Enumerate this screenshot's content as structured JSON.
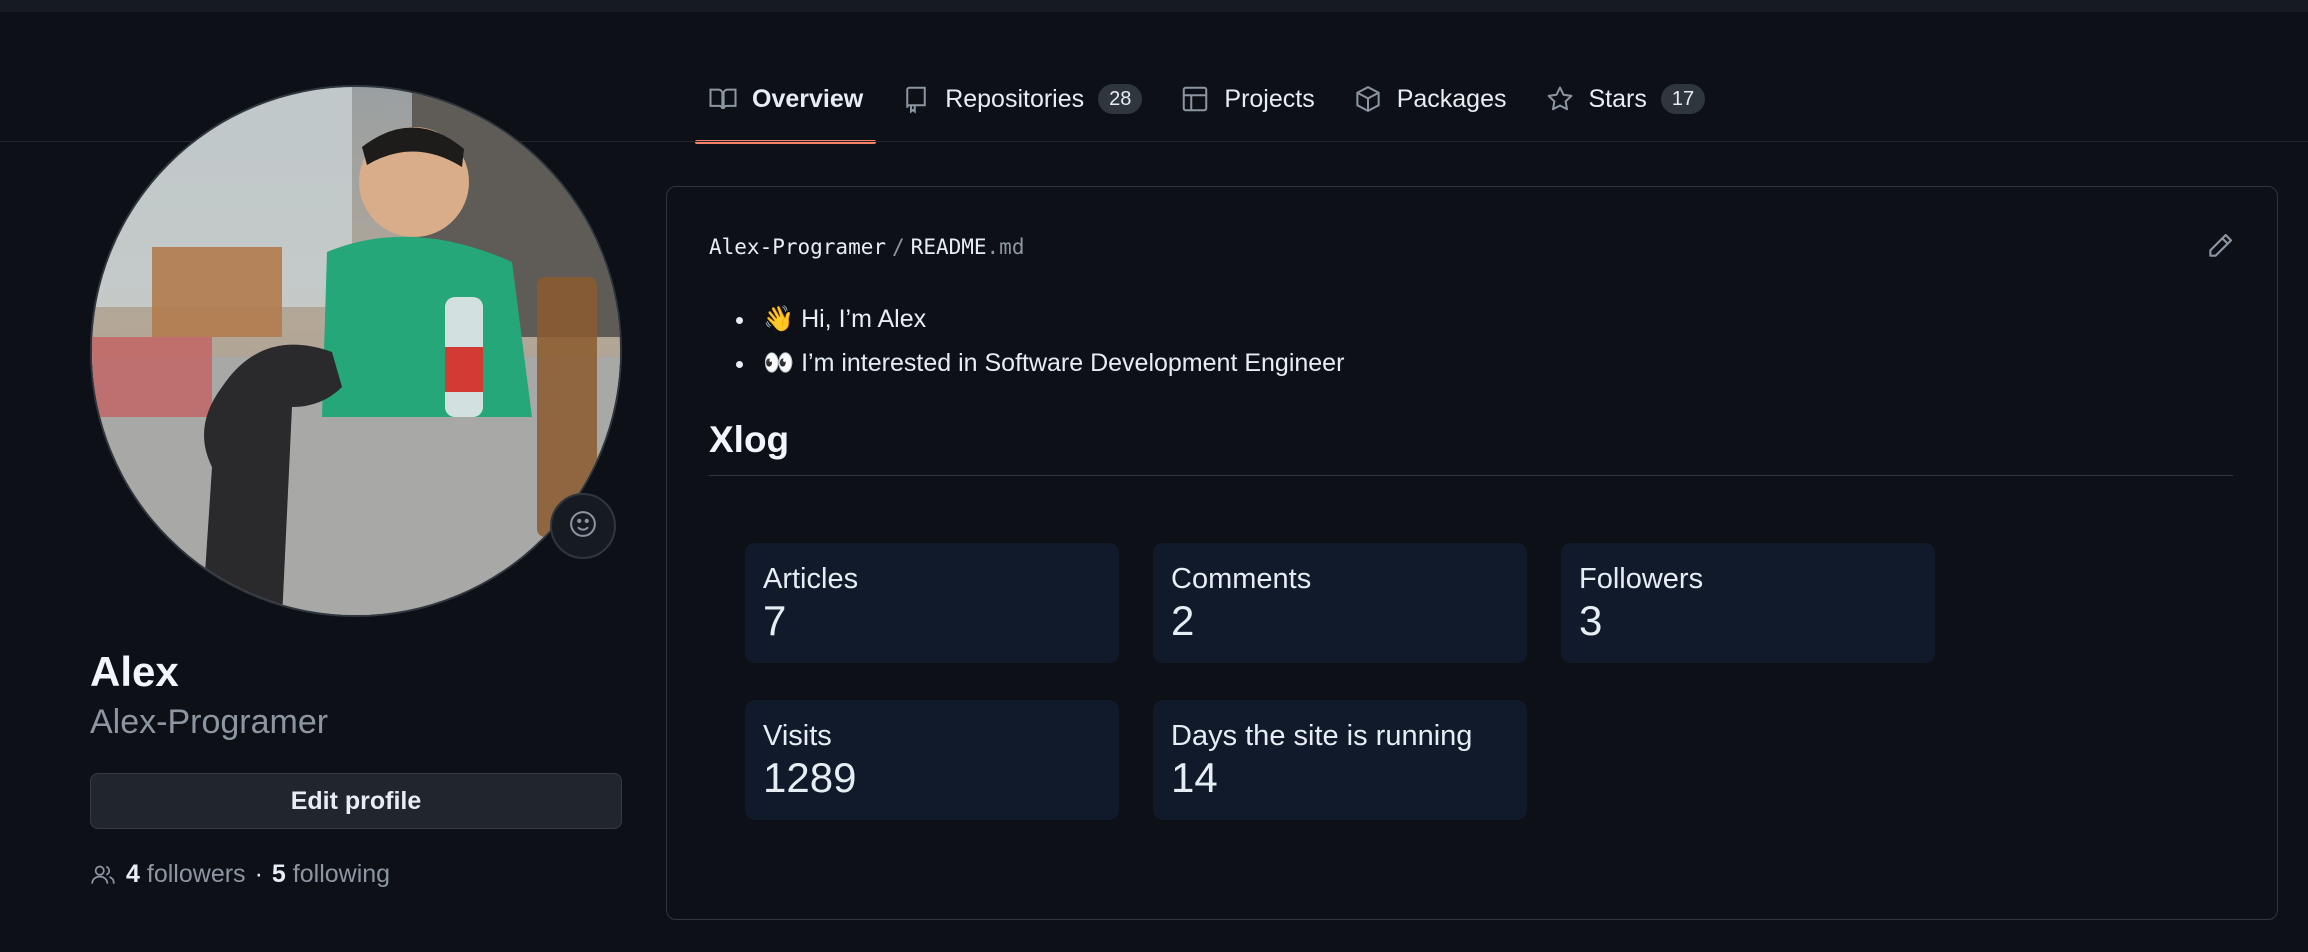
{
  "tabs": [
    {
      "label": "Overview",
      "icon": "book-icon",
      "selected": true
    },
    {
      "label": "Repositories",
      "icon": "repo-icon",
      "count": "28"
    },
    {
      "label": "Projects",
      "icon": "table-icon"
    },
    {
      "label": "Packages",
      "icon": "package-icon"
    },
    {
      "label": "Stars",
      "icon": "star-icon",
      "count": "17"
    }
  ],
  "profile": {
    "name": "Alex",
    "login": "Alex-Programer",
    "edit_label": "Edit profile",
    "followers_count": "4",
    "followers_label": "followers",
    "separator": "·",
    "following_count": "5",
    "following_label": "following"
  },
  "readme": {
    "owner": "Alex-Programer",
    "separator": "/",
    "file": "README",
    "ext": ".md",
    "bullets": [
      "👋 Hi, I’m Alex",
      "👀 I’m interested in Software Development Engineer"
    ],
    "heading": "Xlog",
    "stats": [
      {
        "label": "Articles",
        "value": "7"
      },
      {
        "label": "Comments",
        "value": "2"
      },
      {
        "label": "Followers",
        "value": "3"
      },
      {
        "label": "Visits",
        "value": "1289"
      },
      {
        "label": "Days the site is running",
        "value": "14"
      }
    ]
  },
  "colors": {
    "background": "#0d1117",
    "accent_underline": "#f78166",
    "border": "#30363d",
    "stat_card": "#111a2b"
  }
}
